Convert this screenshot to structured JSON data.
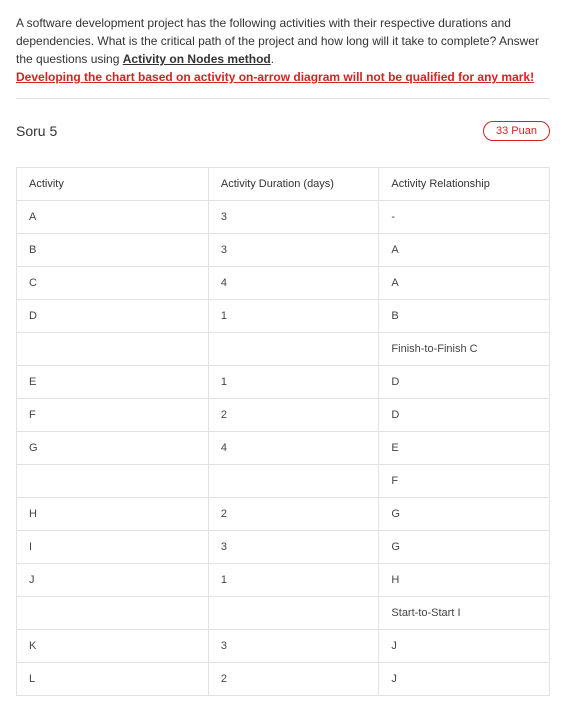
{
  "prompt": {
    "line1": "A software development project has the following activities with their respective durations and dependencies. What is the critical path of the project and how long will it take to complete? Answer the questions using ",
    "method": "Activity on Nodes method",
    "period": ".",
    "warning": "Developing the chart based on activity on-arrow diagram will not be qualified for any mark!"
  },
  "question": {
    "label": "Soru 5",
    "points": "33 Puan"
  },
  "table": {
    "headers": {
      "activity": "Activity",
      "duration": "Activity Duration (days)",
      "relationship": "Activity Relationship"
    },
    "rows": [
      {
        "activity": "A",
        "duration": "3",
        "relationship": "-"
      },
      {
        "activity": "B",
        "duration": "3",
        "relationship": "A"
      },
      {
        "activity": "C",
        "duration": "4",
        "relationship": "A"
      },
      {
        "activity": "D",
        "duration": "1",
        "relationship": "B"
      },
      {
        "activity": "",
        "duration": "",
        "relationship": "Finish-to-Finish C"
      },
      {
        "activity": "E",
        "duration": "1",
        "relationship": "D"
      },
      {
        "activity": "F",
        "duration": "2",
        "relationship": "D"
      },
      {
        "activity": "G",
        "duration": "4",
        "relationship": "E"
      },
      {
        "activity": "",
        "duration": "",
        "relationship": "F"
      },
      {
        "activity": "H",
        "duration": "2",
        "relationship": "G"
      },
      {
        "activity": "I",
        "duration": "3",
        "relationship": "G"
      },
      {
        "activity": "J",
        "duration": "1",
        "relationship": "H"
      },
      {
        "activity": "",
        "duration": "",
        "relationship": "Start-to-Start I"
      },
      {
        "activity": "K",
        "duration": "3",
        "relationship": "J"
      },
      {
        "activity": "L",
        "duration": "2",
        "relationship": "J"
      }
    ]
  }
}
